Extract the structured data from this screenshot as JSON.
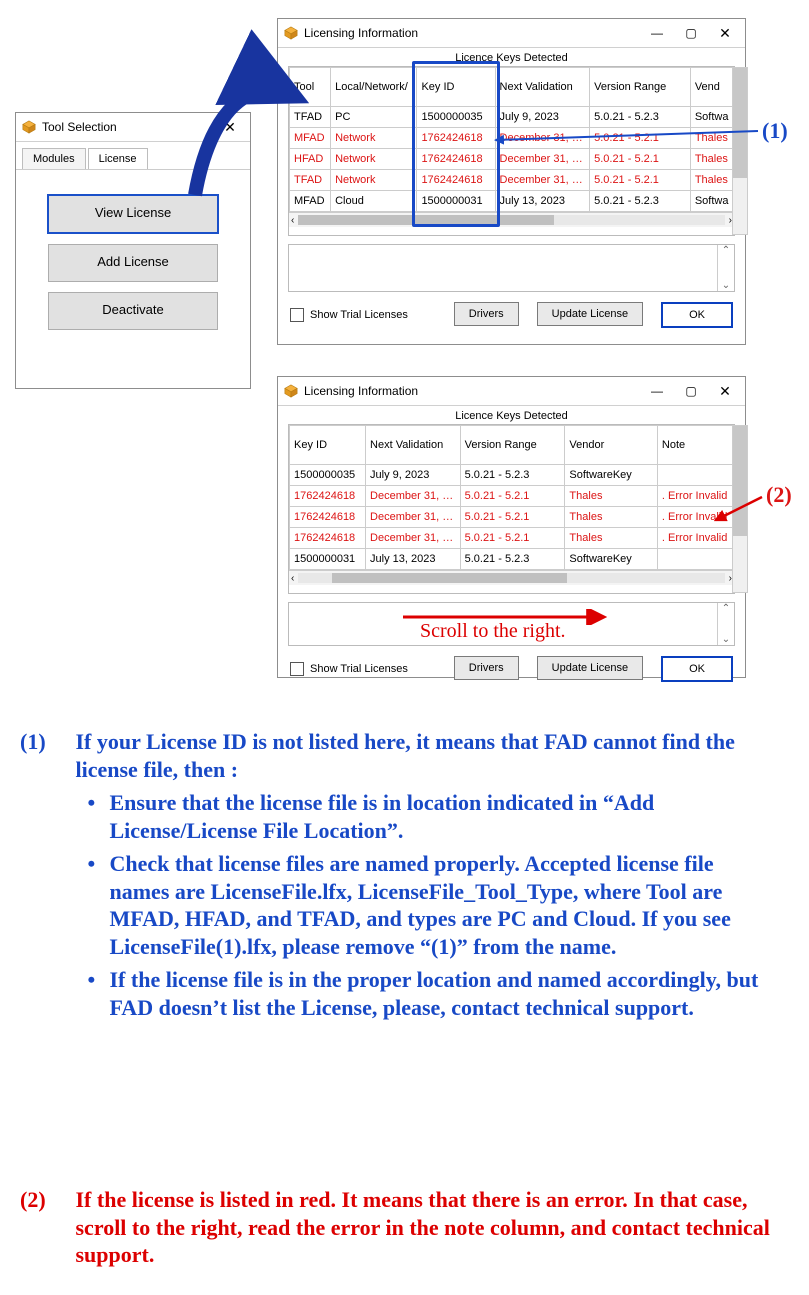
{
  "toolSelection": {
    "title": "Tool Selection",
    "tabs": {
      "modules": "Modules",
      "license": "License"
    },
    "buttons": {
      "view": "View License",
      "add": "Add License",
      "deactivate": "Deactivate"
    }
  },
  "licensing": {
    "title": "Licensing Information",
    "heading": "Licence Keys Detected",
    "checkbox": "Show Trial Licenses",
    "btnDrivers": "Drivers",
    "btnUpdate": "Update License",
    "btnOK": "OK",
    "table1": {
      "headers": {
        "tool": "Tool",
        "local": "Local/Network/",
        "keyid": "Key ID",
        "next": "Next\nValidation",
        "version": "Version Range",
        "vendor": "Vend"
      },
      "rows": [
        {
          "red": false,
          "tool": "TFAD",
          "local": "PC",
          "keyid": "1500000035",
          "next": "July 9, 2023",
          "version": "5.0.21 - 5.2.3",
          "vendor": "Softwa"
        },
        {
          "red": true,
          "tool": "MFAD",
          "local": "Network",
          "keyid": "1762424618",
          "next": "December 31, 20...",
          "version": "5.0.21 - 5.2.1",
          "vendor": "Thales"
        },
        {
          "red": true,
          "tool": "HFAD",
          "local": "Network",
          "keyid": "1762424618",
          "next": "December 31, 20...",
          "version": "5.0.21 - 5.2.1",
          "vendor": "Thales"
        },
        {
          "red": true,
          "tool": "TFAD",
          "local": "Network",
          "keyid": "1762424618",
          "next": "December 31, 20...",
          "version": "5.0.21 - 5.2.1",
          "vendor": "Thales"
        },
        {
          "red": false,
          "tool": "MFAD",
          "local": "Cloud",
          "keyid": "1500000031",
          "next": "July 13, 2023",
          "version": "5.0.21 - 5.2.3",
          "vendor": "Softwa"
        }
      ]
    },
    "table2": {
      "headers": {
        "keyid": "Key ID",
        "next": "Next\nValidation",
        "version": "Version Range",
        "vendor": "Vendor",
        "note": "Note"
      },
      "rows": [
        {
          "red": false,
          "keyid": "1500000035",
          "next": "July 9, 2023",
          "version": "5.0.21 - 5.2.3",
          "vendor": "SoftwareKey",
          "note": ""
        },
        {
          "red": true,
          "keyid": "1762424618",
          "next": "December 31, 20...",
          "version": "5.0.21 - 5.2.1",
          "vendor": "Thales",
          "note": ". Error Invalid"
        },
        {
          "red": true,
          "keyid": "1762424618",
          "next": "December 31, 20...",
          "version": "5.0.21 - 5.2.1",
          "vendor": "Thales",
          "note": ". Error Invalid"
        },
        {
          "red": true,
          "keyid": "1762424618",
          "next": "December 31, 20...",
          "version": "5.0.21 - 5.2.1",
          "vendor": "Thales",
          "note": ". Error Invalid"
        },
        {
          "red": false,
          "keyid": "1500000031",
          "next": "July 13, 2023",
          "version": "5.0.21 - 5.2.3",
          "vendor": "SoftwareKey",
          "note": ""
        }
      ]
    }
  },
  "callouts": {
    "one": "(1)",
    "two": "(2)"
  },
  "scrollHint": "Scroll to the right.",
  "instructions": {
    "one": {
      "num": "(1)",
      "lead": "If your License ID is not listed here, it means that FAD cannot find the license file, then :",
      "bullets": [
        "Ensure that the license file is in location indicated in “Add License/License File Location”.",
        "Check that license files are named properly. Accepted license file names are LicenseFile.lfx, LicenseFile_Tool_Type, where Tool are MFAD, HFAD, and TFAD, and types are PC and Cloud. If you see LicenseFile(1).lfx, please remove “(1)” from the name.",
        "If the license file is in the proper location and named accordingly, but FAD doesn’t list the License, please, contact technical support."
      ]
    },
    "two": {
      "num": "(2)",
      "lead": "If the license is listed in red. It means that there is an error. In that case, scroll to the right, read the error in the note column, and contact technical support."
    }
  }
}
